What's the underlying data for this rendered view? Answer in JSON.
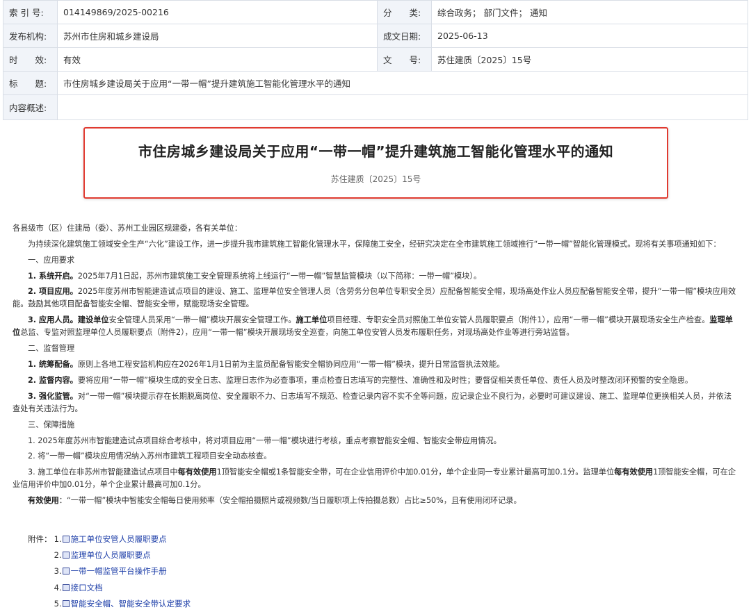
{
  "meta": {
    "index_label": "索 引 号:",
    "index_value": "014149869/2025-00216",
    "category_label": "分　　类:",
    "category_value": "综合政务；  部门文件；  通知",
    "publisher_label": "发布机构:",
    "publisher_value": "苏州市住房和城乡建设局",
    "date_label": "成文日期:",
    "date_value": "2025-06-13",
    "validity_label": "时　　效:",
    "validity_value": "有效",
    "doc_no_label": "文　　号:",
    "doc_no_value": "苏住建质〔2025〕15号",
    "title_label": "标　　题:",
    "title_value": "市住房城乡建设局关于应用“一带一帽”提升建筑施工智能化管理水平的通知",
    "summary_label": "内容概述:",
    "summary_value": ""
  },
  "doc": {
    "title": "市住房城乡建设局关于应用“一带一帽”提升建筑施工智能化管理水平的通知",
    "number": "苏住建质〔2025〕15号"
  },
  "body": {
    "salutation": "各县级市（区）住建局（委）、苏州工业园区规建委，各有关单位：",
    "intro": "为持续深化建筑施工领域安全生产“六化”建设工作，进一步提升我市建筑施工智能化管理水平，保障施工安全，经研究决定在全市建筑施工领域推行“一带一帽”智能化管理模式。现将有关事项通知如下：",
    "s1": "一、应用要求",
    "p1_b": "1. 系统开启。",
    "p1_t": "2025年7月1日起，苏州市建筑施工安全管理系统将上线运行“一带一帽”智慧监管模块（以下简称：一带一帽”模块）。",
    "p2_b": "2. 项目应用。",
    "p2_t": "2025年度苏州市智能建造试点项目的建设、施工、监理单位安全管理人员（含劳务分包单位专职安全员）应配备智能安全帽，现场高处作业人员应配备智能安全带，提升“一带一帽”模块应用效能。鼓励其他项目配备智能安全帽、智能安全带，赋能现场安全管理。",
    "p3_b1": "3. 应用人员。建设单位",
    "p3_t1": "安全管理人员采用“一带一帽”模块开展安全管理工作。",
    "p3_b2": "施工单位",
    "p3_t2": "项目经理、专职安全员对照施工单位安管人员履职要点（附件1），应用“一带一帽”模块开展现场安全生产检查。",
    "p3_b3": "监理单位",
    "p3_t3": "总监、专监对照监理单位人员履职要点（附件2），应用“一带一帽”模块开展现场安全巡查，向施工单位安管人员发布履职任务，对现场高处作业等进行旁站监督。",
    "s2": "二、监督管理",
    "q1_b": "1. 统筹配备。",
    "q1_t": "原则上各地工程安监机构应在2026年1月1日前为主监员配备智能安全帽协同应用“一带一帽”模块，提升日常监督执法效能。",
    "q2_b": "2. 监督内容。",
    "q2_t": "要将应用“一带一帽”模块生成的安全日志、监理日志作为必查事项，重点检查日志填写的完整性、准确性和及时性；要督促相关责任单位、责任人员及时整改闭环预警的安全隐患。",
    "q3_b": "3. 强化监管。",
    "q3_t": "对“一带一帽”模块提示存在长期脱离岗位、安全履职不力、日志填写不规范、检查记录内容不实不全等问题，应记录企业不良行为，必要时可建议建设、施工、监理单位更换相关人员，并依法查处有关违法行为。",
    "s3": "三、保障措施",
    "r1": "1. 2025年度苏州市智能建造试点项目综合考核中，将对项目应用“一带一帽”模块进行考核，重点考察智能安全帽、智能安全带应用情况。",
    "r2": "2. 将“一带一帽”模块应用情况纳入苏州市建筑工程项目安全动态核查。",
    "r3_t1": "3. 施工单位在非苏州市智能建造试点项目中",
    "r3_b1": "每有效使用",
    "r3_t2": "1顶智能安全帽或1条智能安全带，可在企业信用评价中加0.01分，单个企业同一专业累计最高可加0.1分。监理单位",
    "r3_b2": "每有效使用",
    "r3_t3": "1顶智能安全帽，可在企业信用评价中加0.01分，单个企业累计最高可加0.1分。",
    "r4_b": "有效使用",
    "r4_t": "：“一带一帽”模块中智能安全帽每日使用频率（安全帽拍摄照片或视频数/当日履职项上传拍摄总数）占比≥50%，且有使用闭环记录。"
  },
  "attachments": {
    "label": "附件：",
    "items": [
      {
        "num": "1.",
        "title": "施工单位安管人员履职要点"
      },
      {
        "num": "2.",
        "title": "监理单位人员履职要点"
      },
      {
        "num": "3.",
        "title": "一带一帽监管平台操作手册"
      },
      {
        "num": "4.",
        "title": "接口文档"
      },
      {
        "num": "5.",
        "title": "智能安全帽、智能安全带认定要求"
      }
    ]
  },
  "colors": {
    "highlight_border": "#e03a30",
    "link": "#1d3ea8",
    "label_bg": "#f1f4f9"
  }
}
